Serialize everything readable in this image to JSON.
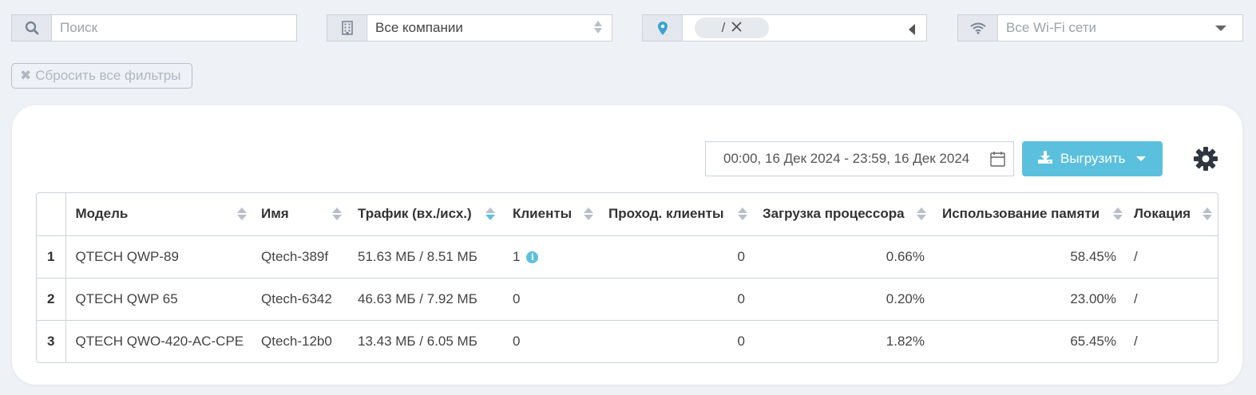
{
  "filters": {
    "search_placeholder": "Поиск",
    "company_value": "Все компании",
    "location_tag": "/",
    "wifi_value": "Все Wi-Fi сети"
  },
  "reset_label": "Сбросить все фильтры",
  "toolbar": {
    "date_range": "00:00, 16 Дек 2024 - 23:59, 16 Дек 2024",
    "export_label": "Выгрузить"
  },
  "table": {
    "columns": [
      "Модель",
      "Имя",
      "Трафик (вх./исх.)",
      "Клиенты",
      "Проход. клиенты",
      "Загрузка процессора",
      "Использование памяти",
      "Локация"
    ],
    "sorted_column": "Трафик (вх./исх.)",
    "rows": [
      {
        "num": "1",
        "model": "QTECH QWP-89",
        "name": "Qtech-389f",
        "traffic": "51.63 МБ / 8.51 МБ",
        "clients": "1",
        "passing": "0",
        "cpu": "0.66%",
        "memory": "58.45%",
        "location": "/"
      },
      {
        "num": "2",
        "model": "QTECH QWP 65",
        "name": "Qtech-6342",
        "traffic": "46.63 МБ / 7.92 МБ",
        "clients": "0",
        "passing": "0",
        "cpu": "0.20%",
        "memory": "23.00%",
        "location": "/"
      },
      {
        "num": "3",
        "model": "QTECH QWO-420-AC-CPE",
        "name": "Qtech-12b0",
        "traffic": "13.43 МБ / 6.05 МБ",
        "clients": "0",
        "passing": "0",
        "cpu": "1.82%",
        "memory": "65.45%",
        "location": "/"
      }
    ]
  },
  "colors": {
    "accent": "#5bc0de",
    "background": "#eef1f6"
  },
  "icons": [
    "search-icon",
    "building-icon",
    "map-pin-icon",
    "wifi-icon",
    "close-icon",
    "calendar-icon",
    "download-icon",
    "gear-icon",
    "info-icon"
  ]
}
